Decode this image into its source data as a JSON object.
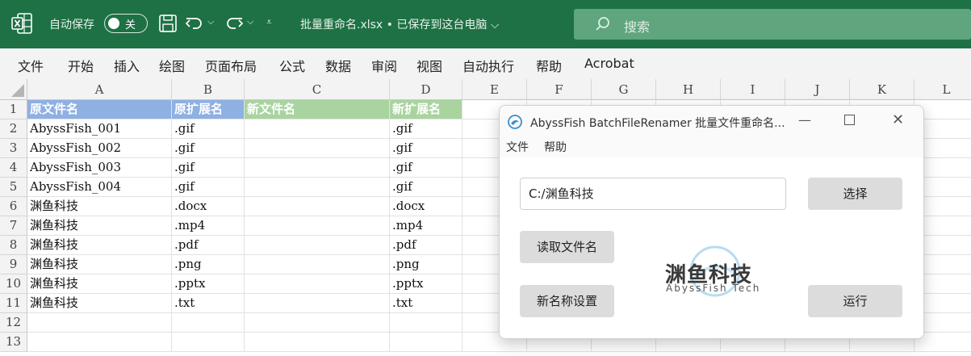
{
  "titlebar": {
    "autosave_label": "自动保存",
    "autosave_state": "关",
    "file_title": "批量重命名.xlsx • 已保存到这台电脑 ⌵",
    "search_placeholder": "搜索",
    "icons": [
      "excel-logo-icon",
      "save-icon",
      "undo-icon",
      "redo-icon",
      "customize-icon",
      "search-icon"
    ]
  },
  "menu": [
    "文件",
    "开始",
    "插入",
    "绘图",
    "页面布局",
    "公式",
    "数据",
    "审阅",
    "视图",
    "自动执行",
    "帮助",
    "Acrobat"
  ],
  "sheet": {
    "columns": [
      "A",
      "B",
      "C",
      "D",
      "E",
      "F",
      "G",
      "H",
      "I",
      "J",
      "K",
      "L"
    ],
    "rows": [
      "1",
      "2",
      "3",
      "4",
      "5",
      "6",
      "7",
      "8",
      "9",
      "10",
      "11",
      "12",
      "13"
    ],
    "header": [
      "原文件名",
      "原扩展名",
      "新文件名",
      "新扩展名"
    ],
    "data": [
      [
        "AbyssFish_001",
        ".gif",
        "",
        ".gif"
      ],
      [
        "AbyssFish_002",
        ".gif",
        "",
        ".gif"
      ],
      [
        "AbyssFish_003",
        ".gif",
        "",
        ".gif"
      ],
      [
        "AbyssFish_004",
        ".gif",
        "",
        ".gif"
      ],
      [
        "渊鱼科技",
        ".docx",
        "",
        ".docx"
      ],
      [
        "渊鱼科技",
        ".mp4",
        "",
        ".mp4"
      ],
      [
        "渊鱼科技",
        ".pdf",
        "",
        ".pdf"
      ],
      [
        "渊鱼科技",
        ".png",
        "",
        ".png"
      ],
      [
        "渊鱼科技",
        ".pptx",
        "",
        ".pptx"
      ],
      [
        "渊鱼科技",
        ".txt",
        "",
        ".txt"
      ]
    ],
    "colors": {
      "header_blue": "#8eb0e3",
      "header_green": "#a9d4a0"
    }
  },
  "dialog": {
    "title": "AbyssFish BatchFileRenamer 批量文件重命名...",
    "menu": [
      "文件",
      "帮助"
    ],
    "path_value": "C:/渊鱼科技",
    "select_button": "选择",
    "read_button": "读取文件名",
    "rename_button": "新名称设置",
    "run_button": "运行",
    "watermark_text": "渊鱼科技",
    "watermark_sub": "AbyssFish Tech"
  }
}
